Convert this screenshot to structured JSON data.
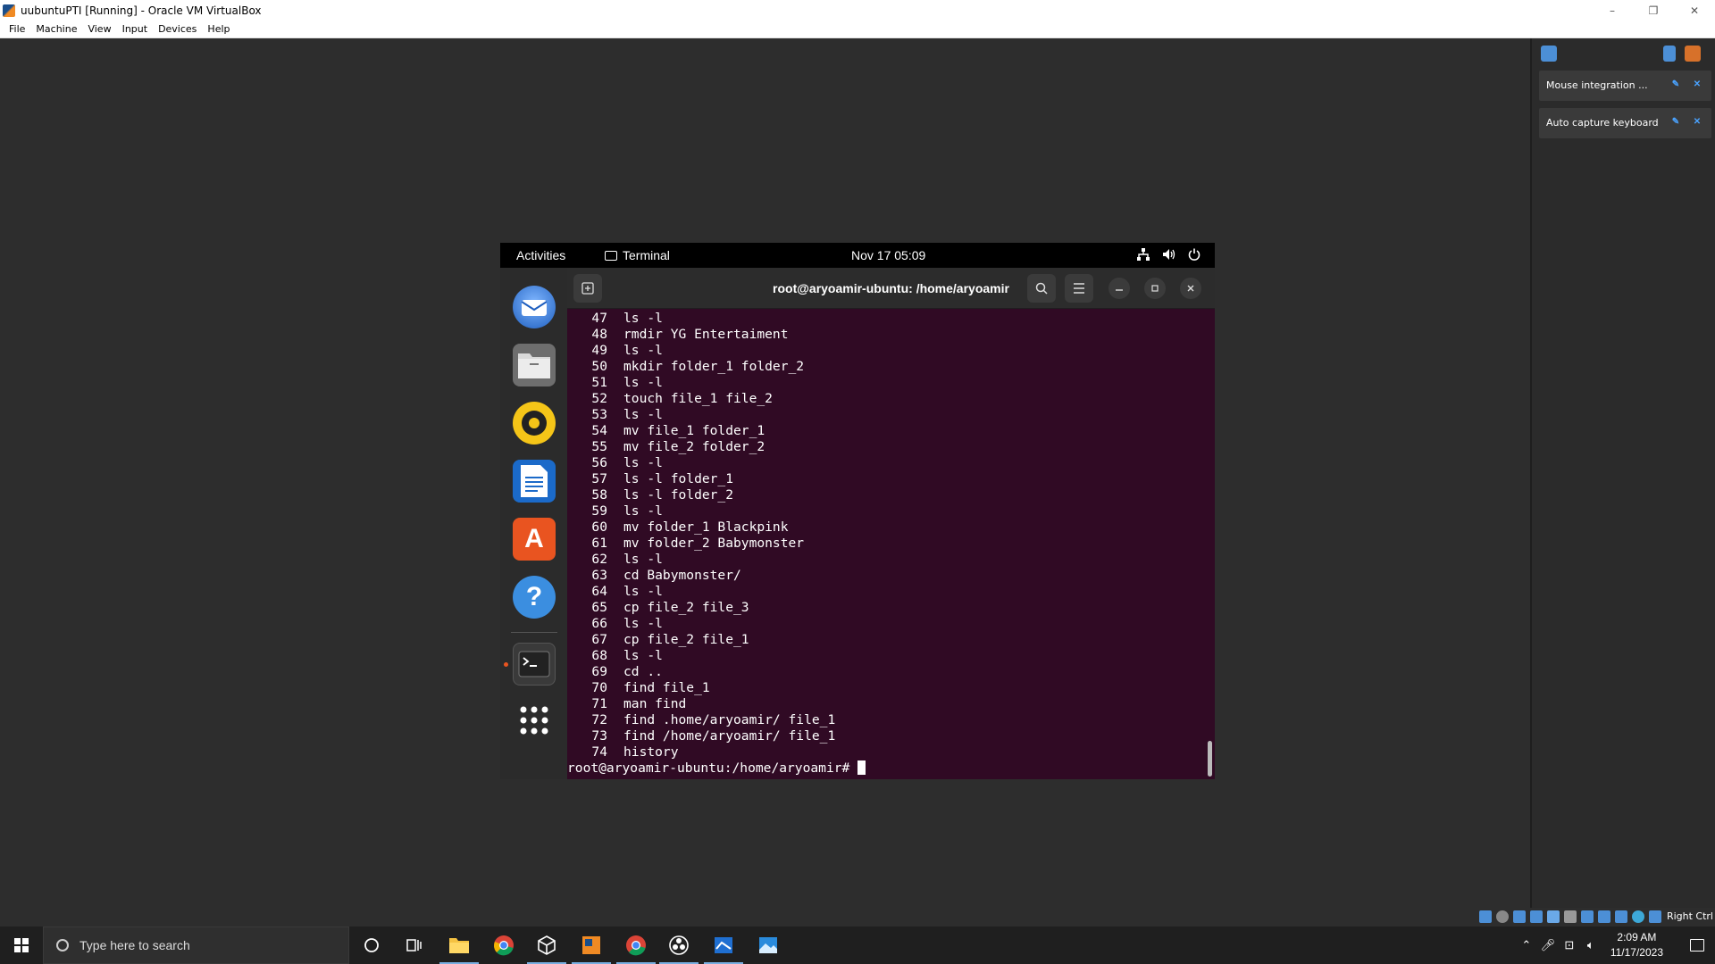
{
  "window": {
    "title": "uubuntuPTI [Running] - Oracle VM VirtualBox",
    "controls": [
      "–",
      "❐",
      "✕"
    ]
  },
  "menu": [
    "File",
    "Machine",
    "View",
    "Input",
    "Devices",
    "Help"
  ],
  "ubuntu": {
    "activities": "Activities",
    "app_name": "Terminal",
    "clock": "Nov 17  05:09",
    "terminal_title": "root@aryoamir-ubuntu: /home/aryoamir",
    "history": [
      {
        "num": "47",
        "cmd": "ls -l"
      },
      {
        "num": "48",
        "cmd": "rmdir YG Entertaiment"
      },
      {
        "num": "49",
        "cmd": "ls -l"
      },
      {
        "num": "50",
        "cmd": "mkdir folder_1 folder_2"
      },
      {
        "num": "51",
        "cmd": "ls -l"
      },
      {
        "num": "52",
        "cmd": "touch file_1 file_2"
      },
      {
        "num": "53",
        "cmd": "ls -l"
      },
      {
        "num": "54",
        "cmd": "mv file_1 folder_1"
      },
      {
        "num": "55",
        "cmd": "mv file_2 folder_2"
      },
      {
        "num": "56",
        "cmd": "ls -l"
      },
      {
        "num": "57",
        "cmd": "ls -l folder_1"
      },
      {
        "num": "58",
        "cmd": "ls -l folder_2"
      },
      {
        "num": "59",
        "cmd": "ls -l"
      },
      {
        "num": "60",
        "cmd": "mv folder_1 Blackpink"
      },
      {
        "num": "61",
        "cmd": "mv folder_2 Babymonster"
      },
      {
        "num": "62",
        "cmd": "ls -l"
      },
      {
        "num": "63",
        "cmd": "cd Babymonster/"
      },
      {
        "num": "64",
        "cmd": "ls -l"
      },
      {
        "num": "65",
        "cmd": "cp file_2 file_3"
      },
      {
        "num": "66",
        "cmd": "ls -l"
      },
      {
        "num": "67",
        "cmd": "cp file_2 file_1"
      },
      {
        "num": "68",
        "cmd": "ls -l"
      },
      {
        "num": "69",
        "cmd": "cd .."
      },
      {
        "num": "70",
        "cmd": "find file_1"
      },
      {
        "num": "71",
        "cmd": "man find"
      },
      {
        "num": "72",
        "cmd": "find .home/aryoamir/ file_1"
      },
      {
        "num": "73",
        "cmd": "find /home/aryoamir/ file_1"
      },
      {
        "num": "74",
        "cmd": "history"
      }
    ],
    "prompt": "root@aryoamir-ubuntu:/home/aryoamir#",
    "dock": [
      "thunderbird-icon",
      "files-icon",
      "rhythmbox-icon",
      "writer-icon",
      "software-icon",
      "help-icon",
      "terminal-icon",
      "show-apps-icon"
    ]
  },
  "side_panel": {
    "notices": [
      "Mouse integration ...",
      "Auto capture keyboard ..."
    ]
  },
  "status_bar": {
    "host_key": "Right Ctrl"
  },
  "taskbar": {
    "search_placeholder": "Type here to search",
    "time": "2:09 AM",
    "date": "11/17/2023"
  },
  "colors": {
    "terminal_bg": "#300a24",
    "ubuntu_orange": "#e95420",
    "vm_bg": "#2d2d2d"
  }
}
